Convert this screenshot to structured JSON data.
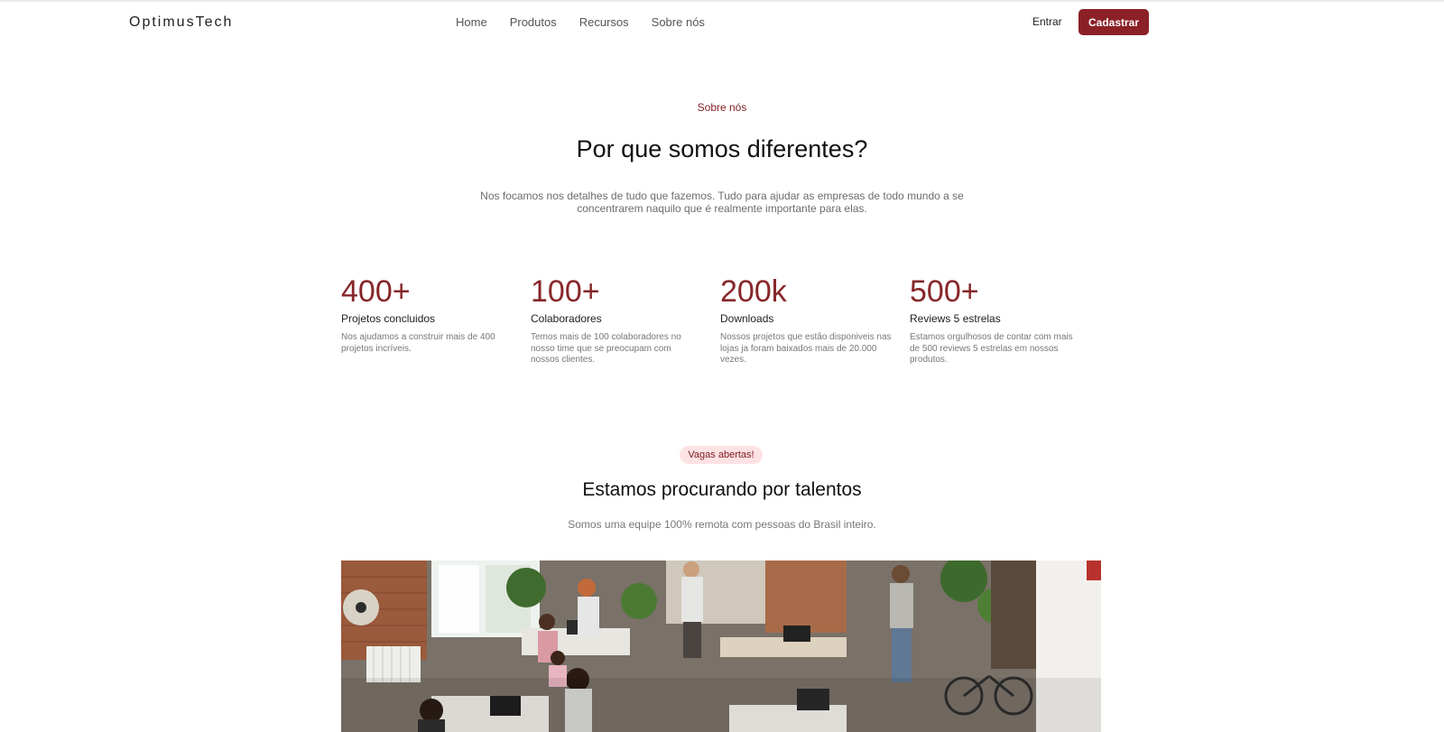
{
  "nav": {
    "logo": "OptimusTech",
    "links": [
      "Home",
      "Produtos",
      "Recursos",
      "Sobre nós"
    ],
    "signin": "Entrar",
    "signup": "Cadastrar"
  },
  "about": {
    "eyebrow": "Sobre nós",
    "title": "Por que somos diferentes?",
    "lead": "Nos focamos nos detalhes de tudo que fazemos. Tudo para ajudar as empresas de todo mundo a se concentrarem naquilo que é realmente importante para elas."
  },
  "stats": [
    {
      "value": "400+",
      "title": "Projetos concluidos",
      "desc": "Nos ajudamos a construir mais de 400 projetos incríveis."
    },
    {
      "value": "100+",
      "title": "Colaboradores",
      "desc": "Temos mais de 100 colaboradores no nosso time que se preocupam com nossos clientes."
    },
    {
      "value": "200k",
      "title": "Downloads",
      "desc": "Nossos projetos que estão disponiveis nas lojas ja foram baixados mais de 20.000 vezes."
    },
    {
      "value": "500+",
      "title": "Reviews 5 estrelas",
      "desc": "Estamos orgulhosos de contar com mais de 500 reviews 5 estrelas em nossos produtos."
    }
  ],
  "jobs": {
    "badge": "Vagas abertas!",
    "title": "Estamos procurando por talentos",
    "subtitle": "Somos uma equipe 100% remota com pessoas do Brasil inteiro."
  },
  "colors": {
    "brand": "#8b2126",
    "badge_bg": "#fde2e4"
  }
}
